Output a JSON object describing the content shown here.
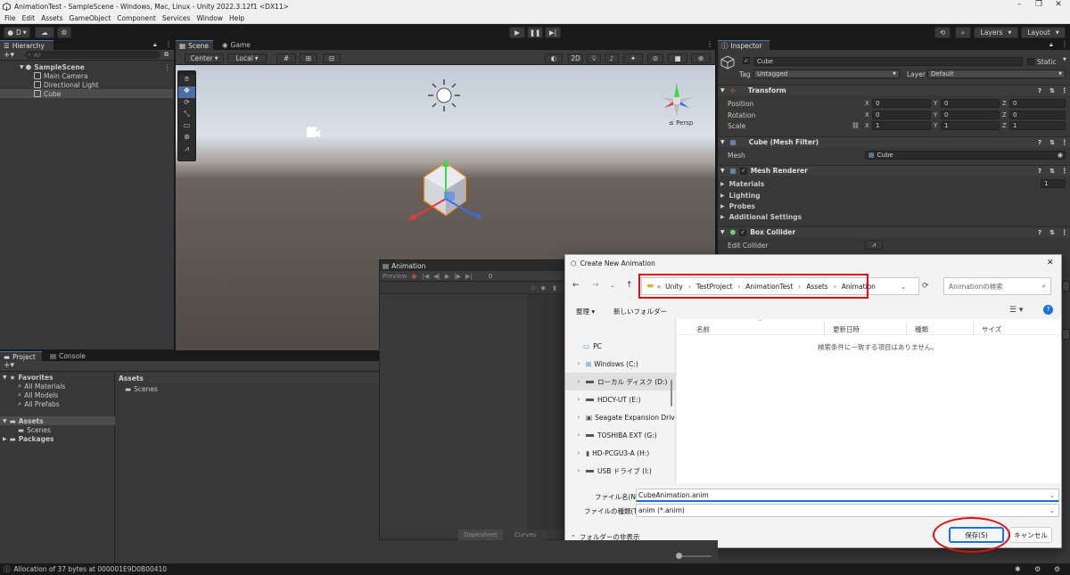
{
  "window": {
    "title": "AnimationTest - SampleScene - Windows, Mac, Linux - Unity 2022.3.12f1 <DX11>",
    "menu": [
      "File",
      "Edit",
      "Assets",
      "GameObject",
      "Component",
      "Services",
      "Window",
      "Help"
    ]
  },
  "toolbar": {
    "account": "D",
    "layers": "Layers",
    "layout": "Layout"
  },
  "hierarchy": {
    "tab": "Hierarchy",
    "search_placeholder": "All",
    "scene": "SampleScene",
    "items": [
      "Main Camera",
      "Directional Light",
      "Cube"
    ]
  },
  "scene_view": {
    "tabs": [
      "Scene",
      "Game"
    ],
    "pivot": "Center",
    "space": "Local",
    "mode_2d": "2D",
    "persp": "Persp"
  },
  "inspector": {
    "tab": "Inspector",
    "object_name": "Cube",
    "static": "Static",
    "tag_label": "Tag",
    "tag": "Untagged",
    "layer_label": "Layer",
    "layer": "Default",
    "transform": {
      "title": "Transform",
      "rows": [
        {
          "label": "Position",
          "x": "0",
          "y": "0",
          "z": "0"
        },
        {
          "label": "Rotation",
          "x": "0",
          "y": "0",
          "z": "0"
        },
        {
          "label": "Scale",
          "x": "1",
          "y": "1",
          "z": "1"
        }
      ]
    },
    "mesh_filter": {
      "title": "Cube (Mesh Filter)",
      "mesh_label": "Mesh",
      "mesh": "Cube"
    },
    "mesh_renderer": {
      "title": "Mesh Renderer",
      "sections": [
        "Materials",
        "Lighting",
        "Probes",
        "Additional Settings"
      ],
      "materials_count": "1"
    },
    "box_collider": {
      "title": "Box Collider",
      "edit_collider": "Edit Collider"
    }
  },
  "project": {
    "tabs": [
      "Project",
      "Console"
    ],
    "favorites": "Favorites",
    "fav_items": [
      "All Materials",
      "All Models",
      "All Prefabs"
    ],
    "assets": "Assets",
    "asset_children": [
      "Scenes"
    ],
    "packages": "Packages",
    "breadcrumb": "Assets",
    "content": [
      "Scenes"
    ]
  },
  "animation": {
    "tab": "Animation",
    "preview": "Preview",
    "frame": "0",
    "dopesheet": "Dopesheet",
    "curves": "Curves"
  },
  "dialog": {
    "title": "Create New Animation",
    "path": [
      "Unity",
      "TestProject",
      "AnimationTest",
      "Assets",
      "Animation"
    ],
    "search_placeholder": "Animationの検索",
    "organize": "整理 ▾",
    "new_folder": "新しいフォルダー",
    "columns": [
      "名前",
      "更新日時",
      "種類",
      "サイズ"
    ],
    "empty_message": "検索条件に一致する項目はありません。",
    "nav": [
      {
        "label": "PC",
        "type": "pc"
      },
      {
        "label": "Windows (C:)",
        "type": "win"
      },
      {
        "label": "ローカル ディスク (D:)",
        "type": "drive",
        "selected": true
      },
      {
        "label": "HDCY-UT (E:)",
        "type": "drive"
      },
      {
        "label": "Seagate Expansion Driv",
        "type": "ext"
      },
      {
        "label": "TOSHIBA EXT (G:)",
        "type": "drive"
      },
      {
        "label": "HD-PCGU3-A (H:)",
        "type": "drive"
      },
      {
        "label": "USB ドライブ (I:)",
        "type": "drive"
      }
    ],
    "filename_label": "ファイル名(N):",
    "filename": "CubeAnimation.anim",
    "filetype_label": "ファイルの種類(T):",
    "filetype": "anim (*.anim)",
    "hide_folders": "フォルダーの非表示",
    "save": "保存(S)",
    "cancel": "キャンセル"
  },
  "status": {
    "message": "Allocation of 37 bytes at 000001E9D0B00410"
  },
  "colors": {
    "unity_panel": "#383838",
    "unity_dark": "#191919",
    "selection_blue": "#3a79bb",
    "annotation_red": "#dd1111"
  }
}
